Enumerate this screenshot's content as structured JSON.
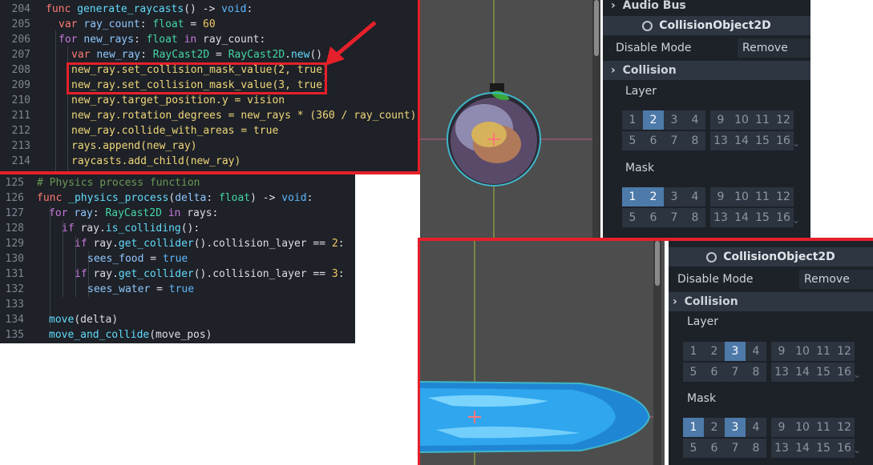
{
  "code_panel_1": {
    "lines": [
      {
        "n": "204",
        "t": "func generate_raycasts() -> void:"
      },
      {
        "n": "205",
        "t": "var ray_count: float = 60"
      },
      {
        "n": "206",
        "t": "for new_rays: float in ray_count:"
      },
      {
        "n": "207",
        "t": "var new_ray: RayCast2D = RayCast2D.new()"
      },
      {
        "n": "208",
        "t": "new_ray.set_collision_mask_value(2, true)"
      },
      {
        "n": "209",
        "t": "new_ray.set_collision_mask_value(3, true)"
      },
      {
        "n": "210",
        "t": "new_ray.target_position.y = vision"
      },
      {
        "n": "211",
        "t": "new_ray.rotation_degrees = new_rays * (360 / ray_count)"
      },
      {
        "n": "212",
        "t": "new_ray.collide_with_areas = true"
      },
      {
        "n": "213",
        "t": "rays.append(new_ray)"
      },
      {
        "n": "214",
        "t": "raycasts.add_child(new_ray)"
      }
    ]
  },
  "code_panel_2": {
    "lines": [
      {
        "n": "125",
        "t": "# Physics process function"
      },
      {
        "n": "126",
        "t": "func _physics_process(delta: float) -> void:"
      },
      {
        "n": "127",
        "t": "for ray: RayCast2D in rays:"
      },
      {
        "n": "128",
        "t": "if ray.is_colliding():"
      },
      {
        "n": "129",
        "t": "if ray.get_collider().collision_layer == 2:"
      },
      {
        "n": "130",
        "t": "sees_food = true"
      },
      {
        "n": "131",
        "t": "if ray.get_collider().collision_layer == 3:"
      },
      {
        "n": "132",
        "t": "sees_water = true"
      },
      {
        "n": "133",
        "t": ""
      },
      {
        "n": "134",
        "t": "move(delta)"
      },
      {
        "n": "135",
        "t": "move_and_collide(move_pos)"
      }
    ]
  },
  "inspector_1": {
    "audio_bus_label": "Audio Bus",
    "object_title": "CollisionObject2D",
    "disable_mode_label": "Disable Mode",
    "disable_mode_value": "Remove",
    "collision_label": "Collision",
    "layer_label": "Layer",
    "mask_label": "Mask",
    "layer_on": [
      2
    ],
    "mask_on": [
      1,
      2
    ]
  },
  "inspector_2": {
    "object_title": "CollisionObject2D",
    "disable_mode_label": "Disable Mode",
    "disable_mode_value": "Remove",
    "collision_label": "Collision",
    "layer_label": "Layer",
    "mask_label": "Mask",
    "layer_on": [
      3
    ],
    "mask_on": [
      1,
      3
    ]
  },
  "colors": {
    "highlight_red": "#e5202a",
    "bit_on": "#4d7aa9",
    "editor_bg": "#1e2127",
    "inspector_bg": "#1d2229"
  },
  "icons": [
    "arrow-annotation-icon",
    "collapse-arrow-icon",
    "object-circle-icon",
    "crosshair-icon",
    "fruit-sprite",
    "water-sprite"
  ]
}
